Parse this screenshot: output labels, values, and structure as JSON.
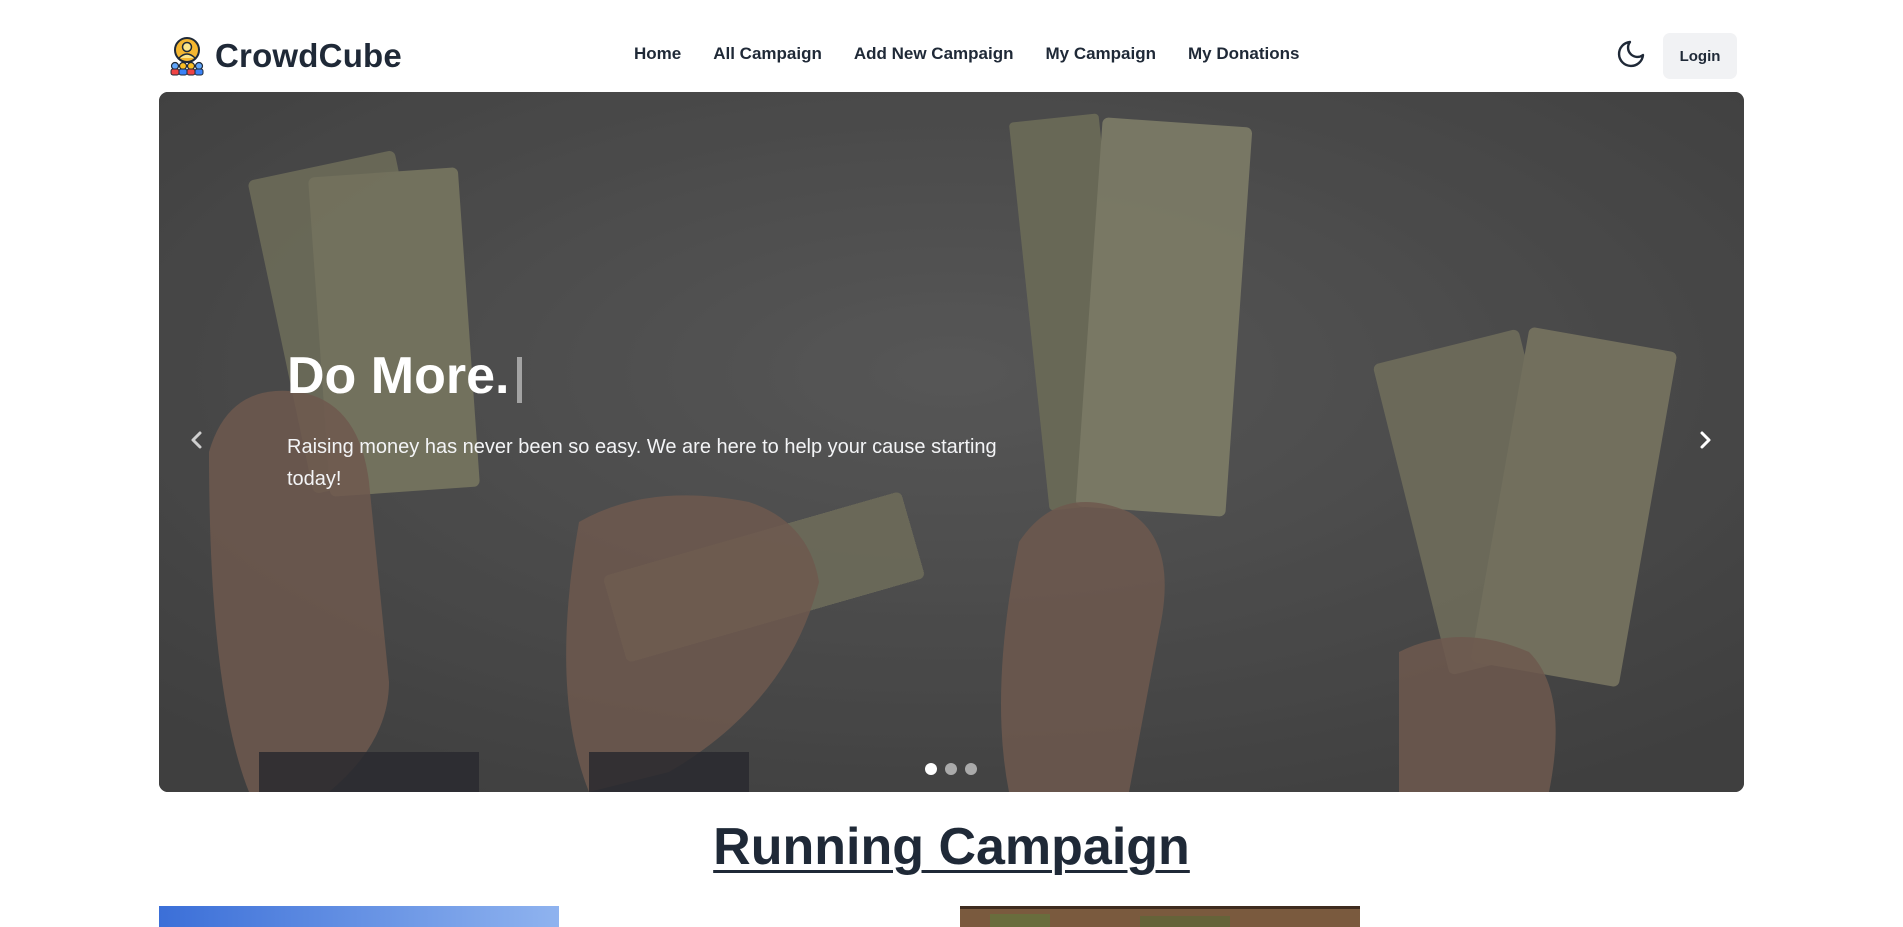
{
  "brand": {
    "name": "CrowdCube",
    "logo_icon": "crowd-people-icon"
  },
  "nav": {
    "links": [
      "Home",
      "All Campaign",
      "Add New Campaign",
      "My Campaign",
      "My Donations"
    ],
    "theme_icon": "moon-icon",
    "login_label": "Login"
  },
  "hero": {
    "title": "Do More.",
    "text": "Raising money has never been so easy. We are here to help your cause starting today!",
    "prev_icon": "chevron-left-icon",
    "next_icon": "chevron-right-icon",
    "slides_count": 3,
    "active_slide": 1
  },
  "section": {
    "title": "Running Campaign"
  },
  "colors": {
    "text": "#1f2937",
    "hero_bg": "#5a5a5a",
    "login_bg": "#f1f2f4",
    "accent_yellow": "#f5b731"
  }
}
